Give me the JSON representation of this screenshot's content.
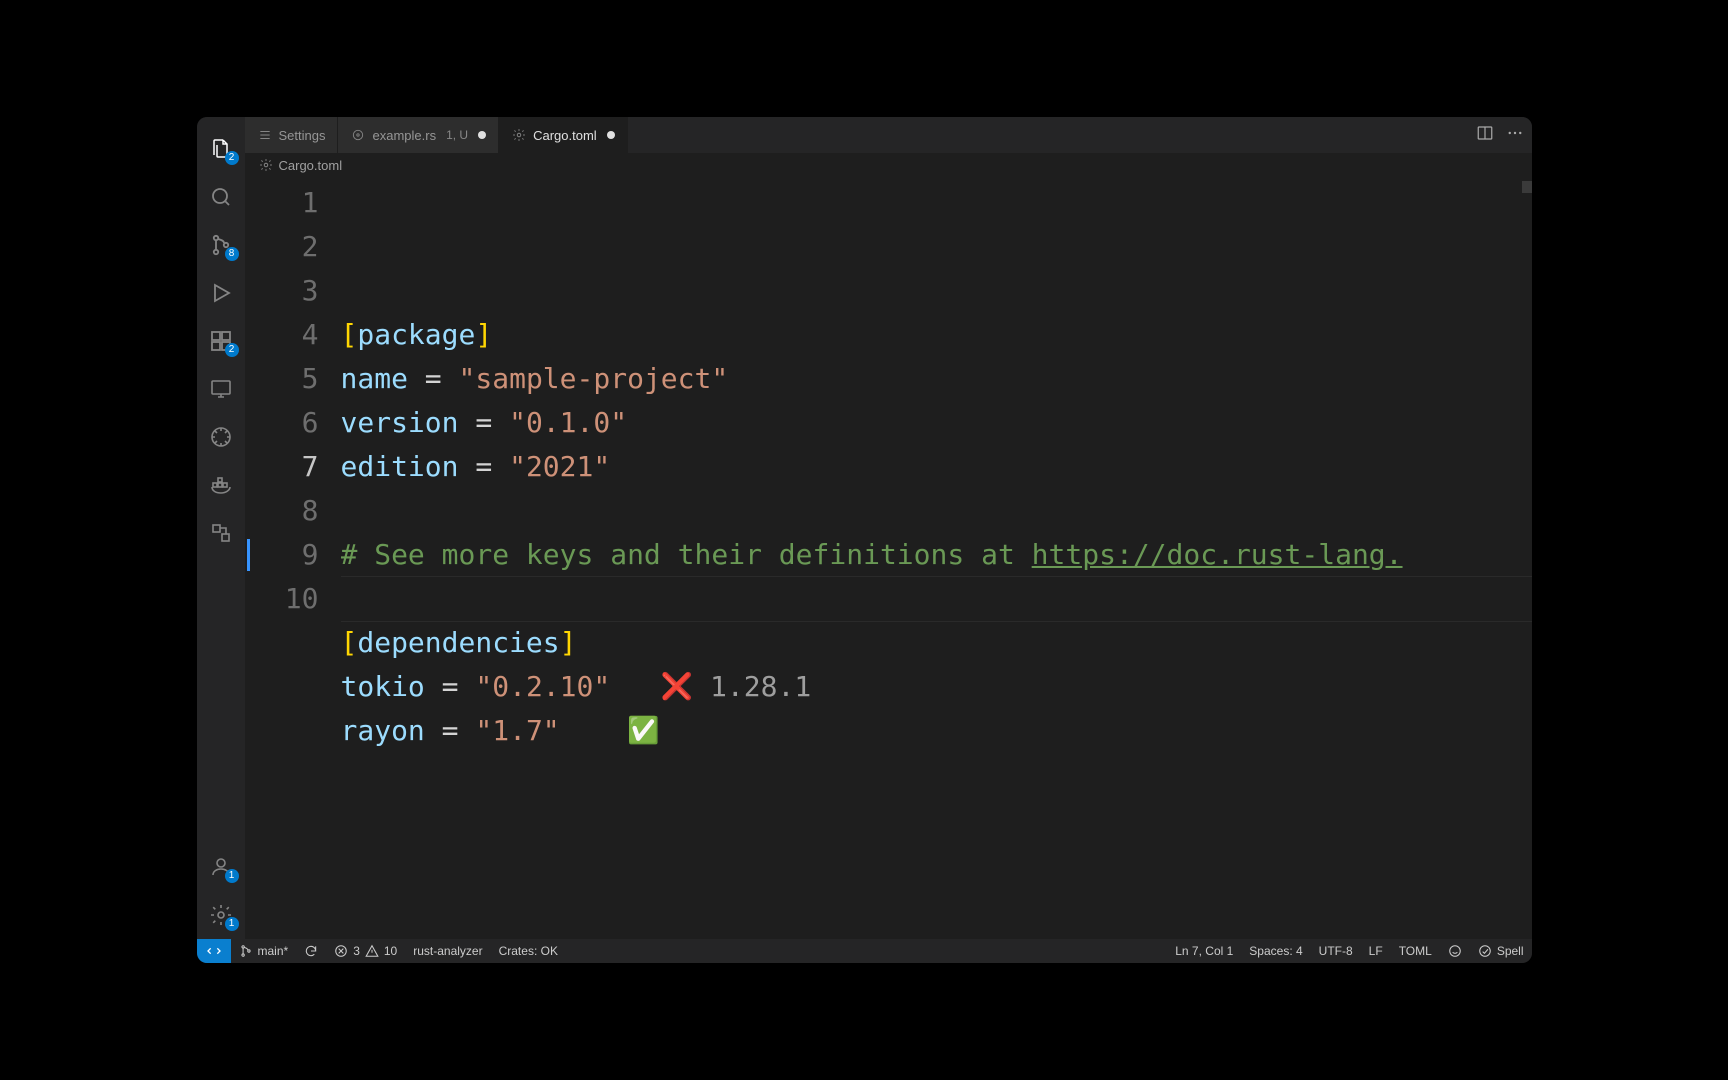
{
  "tabs": [
    {
      "label": "Settings",
      "kind": "settings",
      "active": false,
      "dirty": false,
      "suffix": ""
    },
    {
      "label": "example.rs",
      "kind": "rust",
      "active": false,
      "dirty": true,
      "suffix": "1, U"
    },
    {
      "label": "Cargo.toml",
      "kind": "toml",
      "active": true,
      "dirty": true,
      "suffix": ""
    }
  ],
  "breadcrumb": {
    "file": "Cargo.toml"
  },
  "activity_badges": {
    "explorer": "2",
    "scm": "8",
    "extensions": "2",
    "accounts": "1",
    "settings": "1"
  },
  "code": {
    "lines": [
      {
        "n": 1,
        "segments": [
          {
            "t": "[",
            "c": "bracket"
          },
          {
            "t": "package",
            "c": "key"
          },
          {
            "t": "]",
            "c": "bracket"
          }
        ]
      },
      {
        "n": 2,
        "segments": [
          {
            "t": "name",
            "c": "key"
          },
          {
            "t": " = ",
            "c": "op"
          },
          {
            "t": "\"sample-project\"",
            "c": "str"
          }
        ]
      },
      {
        "n": 3,
        "segments": [
          {
            "t": "version",
            "c": "key"
          },
          {
            "t": " = ",
            "c": "op"
          },
          {
            "t": "\"0.1.0\"",
            "c": "str"
          }
        ]
      },
      {
        "n": 4,
        "segments": [
          {
            "t": "edition",
            "c": "key"
          },
          {
            "t": " = ",
            "c": "op"
          },
          {
            "t": "\"2021\"",
            "c": "str"
          }
        ]
      },
      {
        "n": 5,
        "segments": []
      },
      {
        "n": 6,
        "segments": [
          {
            "t": "# See more keys and their definitions at ",
            "c": "comment"
          },
          {
            "t": "https://doc.rust-lang.",
            "c": "link"
          }
        ]
      },
      {
        "n": 7,
        "current": true,
        "segments": []
      },
      {
        "n": 8,
        "segments": [
          {
            "t": "[",
            "c": "bracket"
          },
          {
            "t": "dependencies",
            "c": "key"
          },
          {
            "t": "]",
            "c": "bracket"
          }
        ]
      },
      {
        "n": 9,
        "marker": "blue",
        "segments": [
          {
            "t": "tokio",
            "c": "key"
          },
          {
            "t": " = ",
            "c": "op"
          },
          {
            "t": "\"0.2.10\"",
            "c": "str"
          },
          {
            "t": "   ",
            "c": "op"
          },
          {
            "t": "❌",
            "c": "emoji"
          },
          {
            "t": " 1.28.1",
            "c": "hint"
          }
        ]
      },
      {
        "n": 10,
        "segments": [
          {
            "t": "rayon",
            "c": "key"
          },
          {
            "t": " = ",
            "c": "op"
          },
          {
            "t": "\"1.7\"",
            "c": "str"
          },
          {
            "t": "    ",
            "c": "op"
          },
          {
            "t": "✅",
            "c": "emoji"
          }
        ]
      }
    ]
  },
  "statusbar": {
    "branch": "main*",
    "errors": "3",
    "warnings": "10",
    "lsp": "rust-analyzer",
    "crates": "Crates: OK",
    "pos": "Ln 7, Col 1",
    "spaces": "Spaces: 4",
    "encoding": "UTF-8",
    "eol": "LF",
    "lang": "TOML",
    "spell": "Spell"
  }
}
